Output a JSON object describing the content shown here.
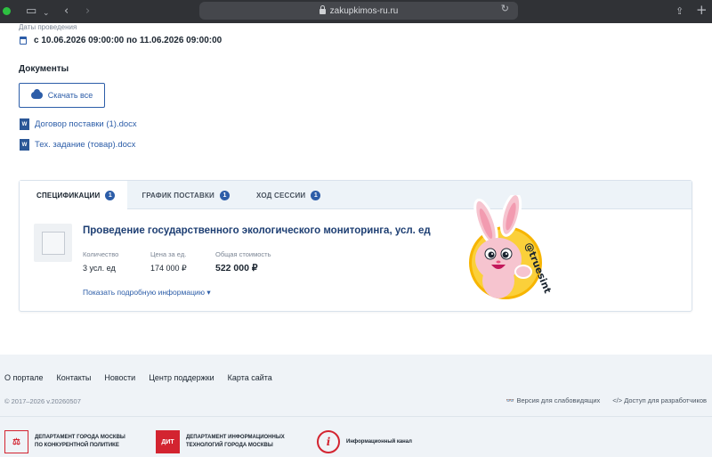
{
  "browser": {
    "url": "zakupkimos-ru.ru"
  },
  "event": {
    "dates_label": "Даты проведения",
    "dates_value": "с 10.06.2026 09:00:00 по 11.06.2026 09:00:00"
  },
  "documents": {
    "title": "Документы",
    "download_all_label": "Скачать все",
    "files": [
      {
        "icon_text": "W",
        "name": "Договор поставки (1).docx"
      },
      {
        "icon_text": "W",
        "name": "Тех. задание (товар).docx"
      }
    ]
  },
  "tabs": [
    {
      "label": "СПЕЦИФИКАЦИИ",
      "badge": "1",
      "active": true
    },
    {
      "label": "ГРАФИК ПОСТАВКИ",
      "badge": "1",
      "active": false
    },
    {
      "label": "ХОД СЕССИИ",
      "badge": "1",
      "active": false
    }
  ],
  "spec_item": {
    "title": "Проведение государственного экологического мониторинга, усл. ед",
    "quantity_label": "Количество",
    "quantity_value": "3 усл. ед",
    "price_label": "Цена за ед.",
    "price_value": "174 000 ₽",
    "total_label": "Общая стоимость",
    "total_value": "522 000 ₽",
    "more_link": "Показать подробную информацию ▾"
  },
  "sticker": {
    "text": "@truesint"
  },
  "footer": {
    "links": [
      "О портале",
      "Контакты",
      "Новости",
      "Центр поддержки",
      "Карта сайта"
    ],
    "copyright": "© 2017–2026 v.20260507",
    "accessibility": "Версия для слабовидящих",
    "developers": "</> Доступ для разработчиков",
    "partners": [
      {
        "line1": "ДЕПАРТАМЕНТ ГОРОДА МОСКВЫ",
        "line2": "ПО КОНКУРЕНТНОЙ ПОЛИТИКЕ"
      },
      {
        "logo_text": "ДИТ",
        "line1": "ДЕПАРТАМЕНТ ИНФОРМАЦИОННЫХ",
        "line2": "ТЕХНОЛОГИЙ ГОРОДА МОСКВЫ"
      },
      {
        "logo_text": "i",
        "line1": "Информационный канал",
        "line2": ""
      }
    ]
  },
  "colors": {
    "accent": "#2c5da8",
    "brand_red": "#d32430",
    "footer_bg": "#eff3f7"
  }
}
